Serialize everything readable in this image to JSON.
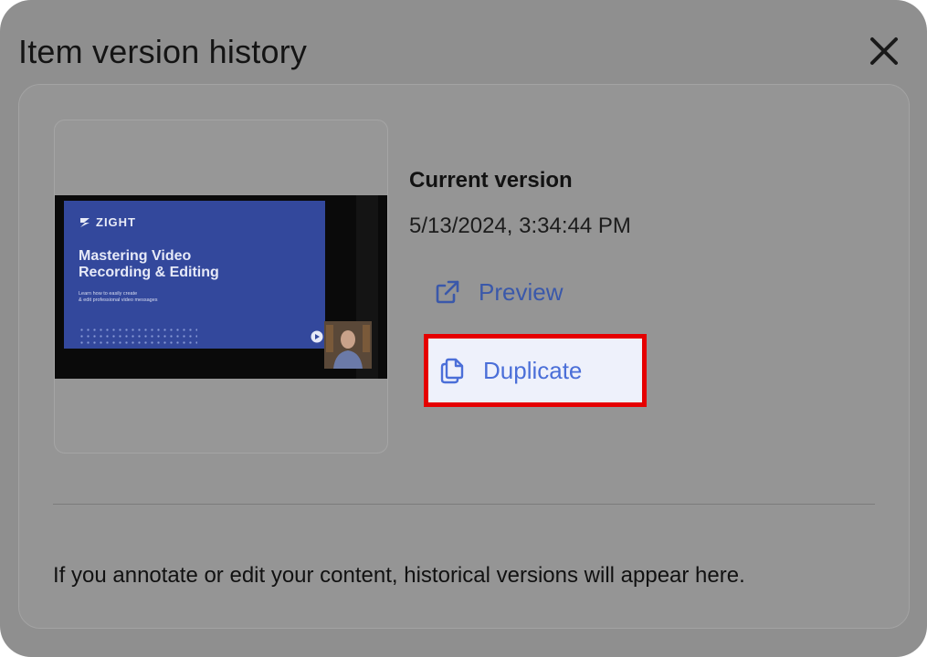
{
  "dialog": {
    "title": "Item version history",
    "close_icon": "close-icon"
  },
  "thumbnail": {
    "brand": "ZIGHT",
    "heading_line1": "Mastering Video",
    "heading_line2": "Recording & Editing",
    "sub_line1": "Learn how to easily create",
    "sub_line2": "& edit professional video messages"
  },
  "version": {
    "label": "Current version",
    "timestamp": "5/13/2024, 3:34:44 PM"
  },
  "actions": {
    "preview_label": "Preview",
    "preview_icon": "external-link-icon",
    "duplicate_label": "Duplicate",
    "duplicate_icon": "copy-icon"
  },
  "footer": {
    "note": "If you annotate or edit your content, historical versions will appear here."
  },
  "colors": {
    "accent": "#3a58aa",
    "highlight": "#e50000",
    "overlay": "#8f8f8f"
  }
}
